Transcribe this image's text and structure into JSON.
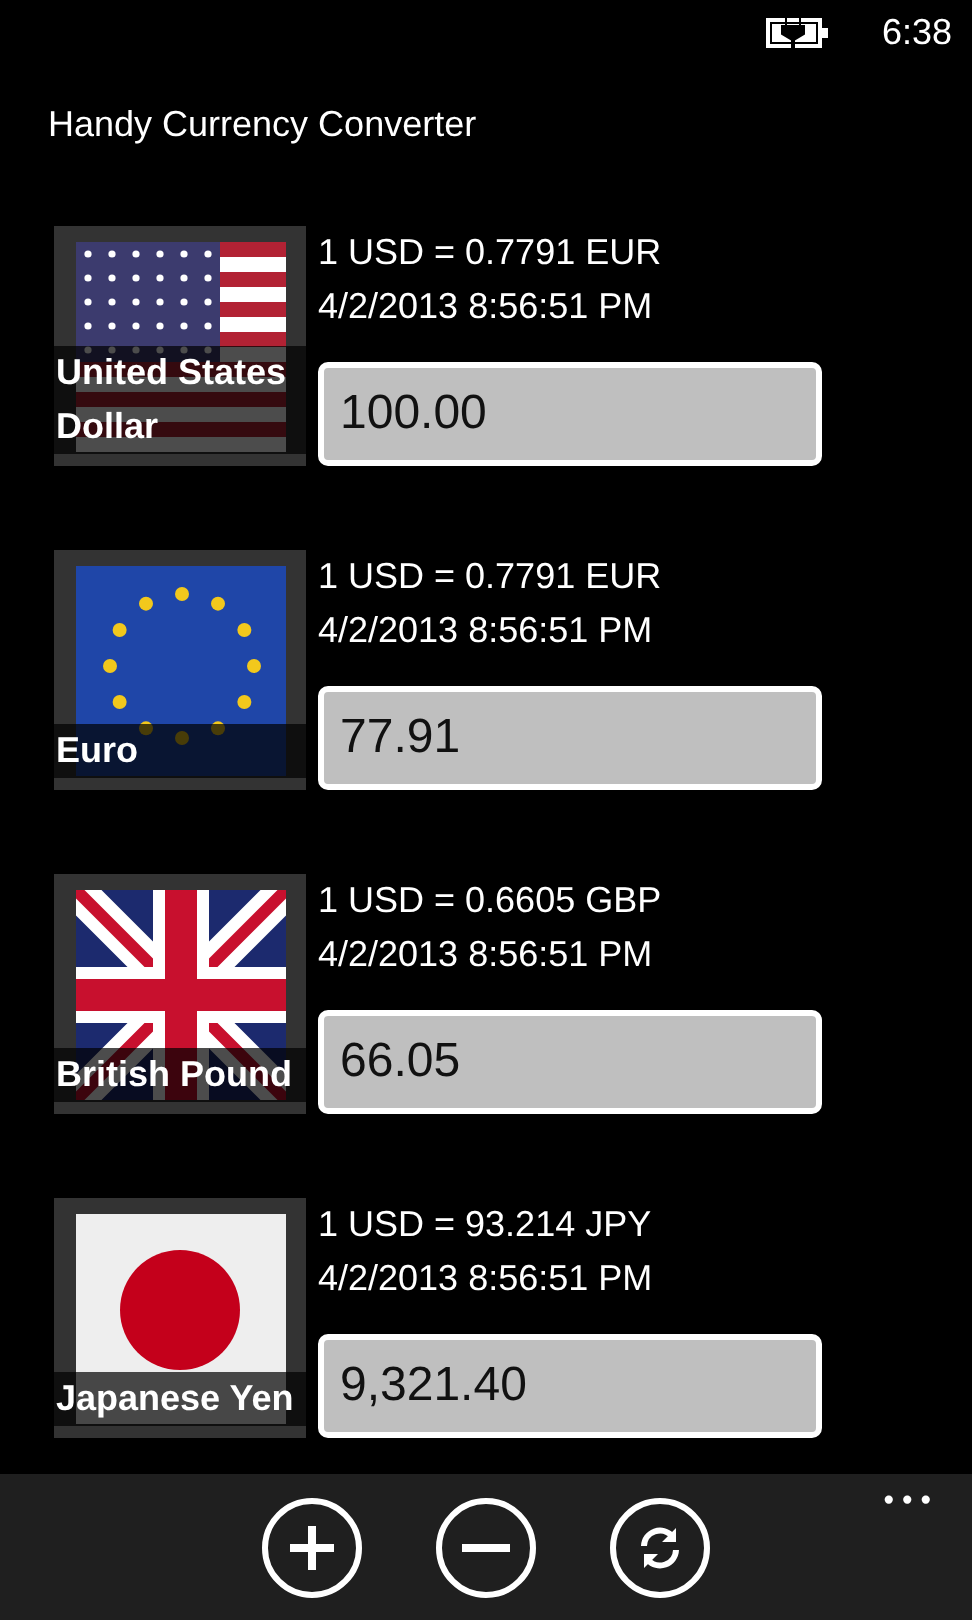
{
  "status_bar": {
    "time": "6:38"
  },
  "app_title": "Handy Currency Converter",
  "currencies": [
    {
      "kind": "us",
      "name": "United States Dollar",
      "rate": "1 USD = 0.7791 EUR",
      "updated": "4/2/2013 8:56:51 PM",
      "amount": "100.00"
    },
    {
      "kind": "eu",
      "name": "Euro",
      "rate": "1 USD = 0.7791 EUR",
      "updated": "4/2/2013 8:56:51 PM",
      "amount": "77.91"
    },
    {
      "kind": "gb",
      "name": "British Pound",
      "rate": "1 USD = 0.6605 GBP",
      "updated": "4/2/2013 8:56:51 PM",
      "amount": "66.05"
    },
    {
      "kind": "jp",
      "name": "Japanese Yen",
      "rate": "1 USD = 93.214 JPY",
      "updated": "4/2/2013 8:56:51 PM",
      "amount": "9,321.40"
    }
  ],
  "app_bar": {
    "buttons": [
      {
        "kind": "add"
      },
      {
        "kind": "remove"
      },
      {
        "kind": "refresh"
      }
    ],
    "more": "•••"
  }
}
